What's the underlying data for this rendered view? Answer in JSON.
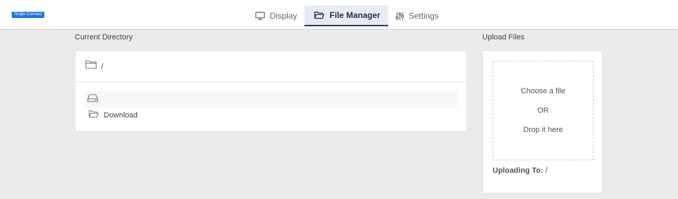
{
  "header": {
    "logo_text": "Single Connect",
    "tabs": [
      {
        "label": "Display",
        "icon": "monitor-icon",
        "active": false
      },
      {
        "label": "File Manager",
        "icon": "folder-open-icon",
        "active": true
      },
      {
        "label": "Settings",
        "icon": "sliders-icon",
        "active": false
      }
    ]
  },
  "directory": {
    "title": "Current Directory",
    "current_path": "/",
    "items": [
      {
        "type": "drive",
        "label": ""
      },
      {
        "type": "folder",
        "label": "Download"
      }
    ]
  },
  "upload": {
    "title": "Upload Files",
    "choose_text": "Choose a file",
    "or_text": "OR",
    "drop_text": "Drop it here",
    "uploading_label": "Uploading To:",
    "uploading_path": "/"
  }
}
